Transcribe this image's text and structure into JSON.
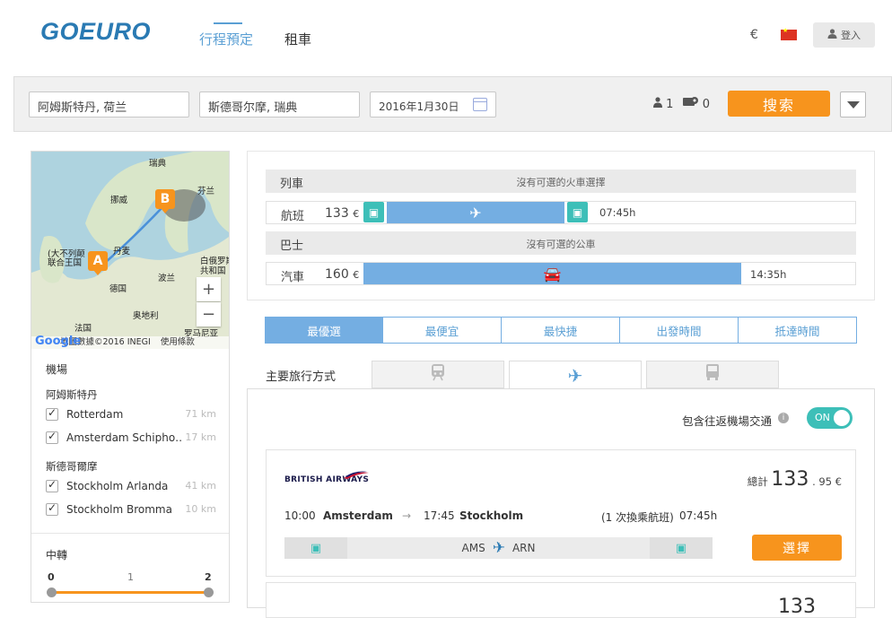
{
  "header": {
    "logo": "GOEURO",
    "nav": {
      "trip": "行程預定",
      "car": "租車"
    },
    "currency": "€",
    "login": "登入"
  },
  "search": {
    "from": "阿姆斯特丹, 荷兰",
    "to": "斯德哥尔摩, 瑞典",
    "date": "2016年1月30日",
    "adults": "1",
    "bikes": "0",
    "search_label": "搜索"
  },
  "map": {
    "labels": {
      "sweden": "瑞典",
      "norway": "挪威",
      "finland": "芬兰",
      "denmark": "丹麦",
      "uk": "(大不列颠\n联合王国",
      "belarus": "白俄罗斯\n共和国",
      "germany": "德国",
      "poland": "波兰",
      "austria": "奥地利",
      "france": "法国",
      "romania": "罗马尼亚"
    },
    "footer": "地圖數據©2016 INEGI",
    "terms": "使用條款",
    "google": "Google",
    "pin_a": "A",
    "pin_b": "B"
  },
  "filters": {
    "airports_title": "機場",
    "origin_city": "阿姆斯特丹",
    "origin_airports": [
      {
        "name": "Rotterdam",
        "km": "71 km"
      },
      {
        "name": "Amsterdam Schipho…",
        "km": "17 km"
      }
    ],
    "dest_city": "斯德哥爾摩",
    "dest_airports": [
      {
        "name": "Stockholm Arlanda",
        "km": "41 km"
      },
      {
        "name": "Stockholm Bromma",
        "km": "10 km"
      }
    ],
    "transfer_title": "中轉",
    "transfer_ticks": [
      "0",
      "1",
      "2"
    ],
    "transfer_range": {
      "min": 0,
      "max": 2
    }
  },
  "summary": {
    "train": {
      "label": "列車",
      "msg": "沒有可選的火車選擇"
    },
    "flight": {
      "label": "航班",
      "price": "133",
      "currency": "€",
      "duration": "07:45h"
    },
    "bus": {
      "label": "巴士",
      "msg": "沒有可選的公車"
    },
    "car": {
      "label": "汽車",
      "price": "160",
      "currency": "€",
      "duration": "14:35h"
    }
  },
  "sort_tabs": [
    "最優選",
    "最便宜",
    "最快捷",
    "出發時間",
    "抵達時間"
  ],
  "mode": {
    "label": "主要旅行方式",
    "tabs": [
      "train-icon",
      "plane-icon",
      "bus-icon"
    ]
  },
  "results": {
    "toggle_label": "包含往返機場交通",
    "toggle_state": "ON",
    "cards": [
      {
        "airline": "BRITISH AIRWAYS",
        "total_label": "總計",
        "price_main": "133",
        "price_cents": ". 95",
        "currency": "€",
        "depart_time": "10:00",
        "depart_city": "Amsterdam",
        "arrive_time": "17:45",
        "arrive_city": "Stockholm",
        "stops": "(1 次換乘航班)",
        "duration": "07:45h",
        "from_code": "AMS",
        "to_code": "ARN",
        "select_label": "選擇"
      }
    ],
    "next_card_price": "133"
  },
  "colors": {
    "brand": "#2a7ab3",
    "accent": "#f7941d",
    "blue": "#74aee2",
    "teal": "#3dbfb8"
  }
}
